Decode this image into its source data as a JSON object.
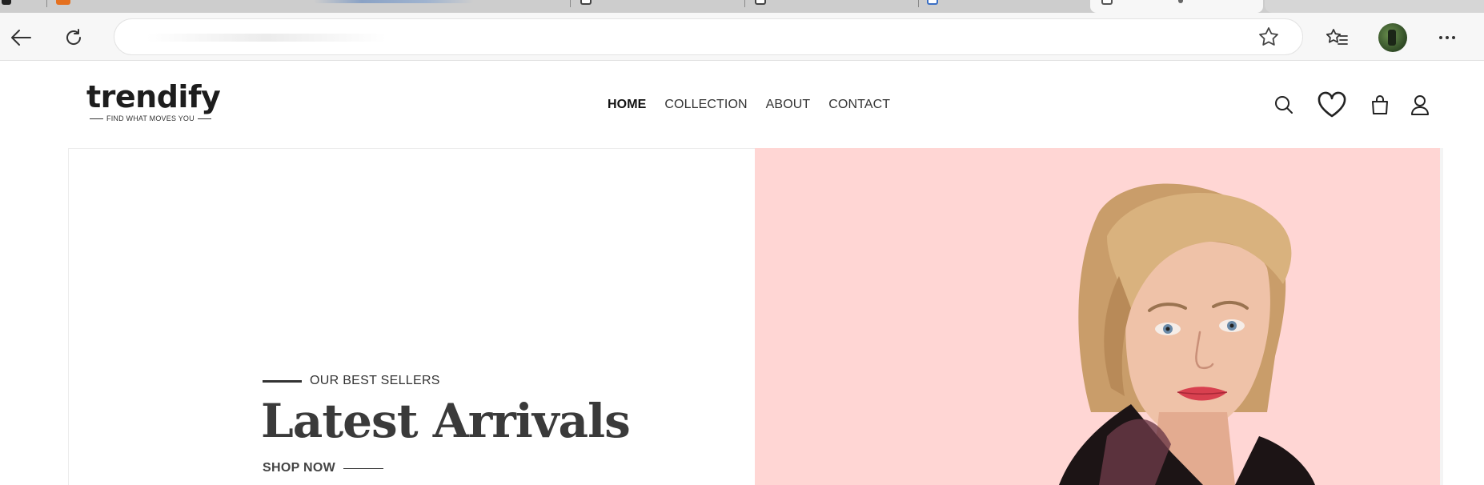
{
  "site": {
    "logo": {
      "word": "trendify",
      "tagline": "FIND WHAT MOVES YOU"
    },
    "nav": [
      {
        "label": "HOME",
        "active": true
      },
      {
        "label": "COLLECTION",
        "active": false
      },
      {
        "label": "ABOUT",
        "active": false
      },
      {
        "label": "CONTACT",
        "active": false
      }
    ],
    "header_icons": [
      "search-icon",
      "heart-icon",
      "shopping-bag-icon",
      "user-icon"
    ]
  },
  "hero": {
    "eyebrow": "OUR BEST SELLERS",
    "title": "Latest Arrivals",
    "cta": "SHOP NOW",
    "image_bg": "#ffd6d4"
  },
  "browser": {
    "toolbar_icons": [
      "back-icon",
      "reload-icon",
      "favorite-star-icon",
      "favorites-list-icon",
      "profile-avatar",
      "more-menu-icon"
    ]
  },
  "colors": {
    "accent_logo": "#c8955e",
    "text_dark": "#222222",
    "hero_pink": "#ffd6d4"
  }
}
